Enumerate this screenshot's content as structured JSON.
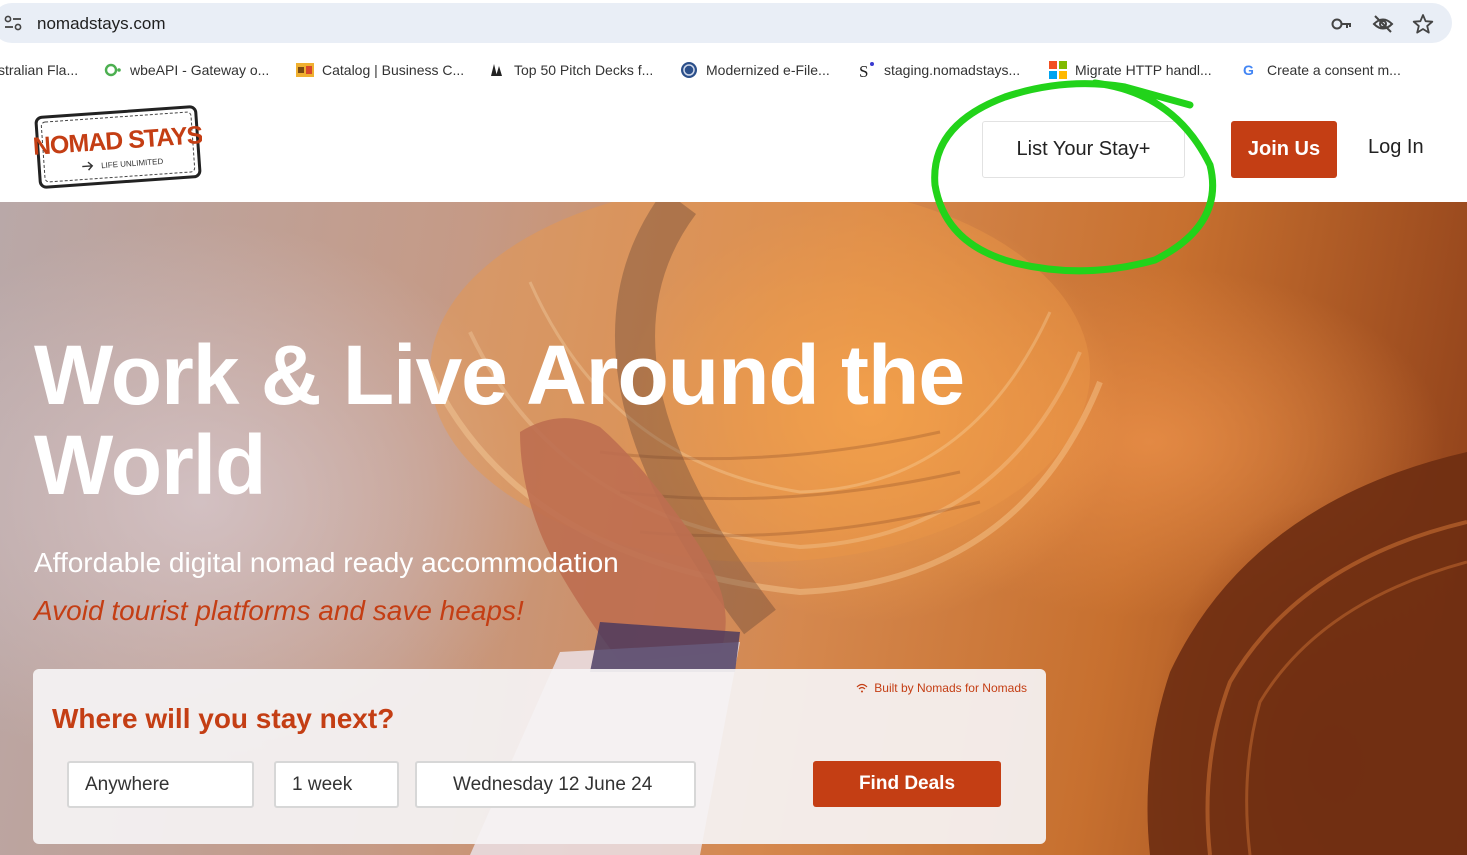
{
  "browser": {
    "url": "nomadstays.com",
    "icons": [
      "site-info-icon",
      "key-icon",
      "eye-off-icon",
      "star-icon"
    ],
    "bookmarks": [
      {
        "label": "stralian Fla...",
        "icon": "flag-icon"
      },
      {
        "label": "wbeAPI - Gateway o...",
        "icon": "gateway-icon"
      },
      {
        "label": "Catalog | Business C...",
        "icon": "catalog-icon"
      },
      {
        "label": "Top 50 Pitch Decks f...",
        "icon": "pitch-deck-icon"
      },
      {
        "label": "Modernized e-File...",
        "icon": "efile-icon"
      },
      {
        "label": "staging.nomadstays...",
        "icon": "staging-icon"
      },
      {
        "label": "Migrate HTTP handl...",
        "icon": "microsoft-icon"
      },
      {
        "label": "Create a consent m...",
        "icon": "google-icon"
      }
    ]
  },
  "header": {
    "logo_title": "NOMAD STAYS",
    "logo_tagline": "LIFE UNLIMITED",
    "list_stay_label": "List Your Stay+",
    "join_label": "Join Us",
    "login_label": "Log In",
    "annotation_color": "#22d31a"
  },
  "hero": {
    "title_line1": "Work & Live Around the",
    "title_line2": "World",
    "subtitle": "Affordable digital nomad ready accommodation",
    "tagline": "Avoid tourist platforms and save heaps!"
  },
  "search": {
    "built_by": "Built by Nomads for Nomads",
    "title": "Where will you stay next?",
    "where_value": "Anywhere",
    "duration_value": "1 week",
    "date_value": "Wednesday 12 June 24",
    "find_label": "Find Deals"
  },
  "colors": {
    "brand": "#c43e14",
    "omnibox": "#e9eef6"
  }
}
